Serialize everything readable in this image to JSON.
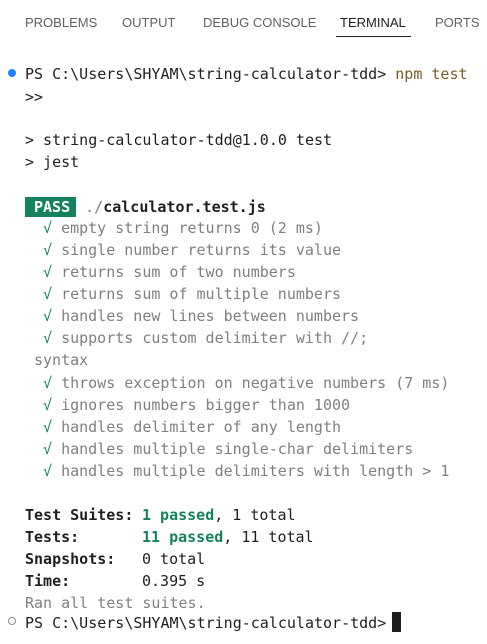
{
  "panel": {
    "tabs": [
      {
        "label": "PROBLEMS"
      },
      {
        "label": "OUTPUT"
      },
      {
        "label": "DEBUG CONSOLE"
      },
      {
        "label": "TERMINAL"
      },
      {
        "label": "PORTS"
      }
    ],
    "active_tab": "TERMINAL"
  },
  "terminal": {
    "prompt": "PS C:\\Users\\SHYAM\\string-calculator-tdd>",
    "command": "npm test",
    "continuation": ">>",
    "script_line_1": "> string-calculator-tdd@1.0.0 test",
    "script_line_2": "> jest",
    "pass_label": "PASS",
    "test_file_dir": "./",
    "test_file_name": "calculator.test.js",
    "check_glyph": "√",
    "tests": [
      "empty string returns 0 (2 ms)",
      "single number returns its value",
      "returns sum of two numbers",
      "returns sum of multiple numbers",
      "handles new lines between numbers",
      "supports custom delimiter with //;",
      "throws exception on negative numbers (7 ms)",
      "ignores numbers bigger than 1000",
      "handles delimiter of any length",
      "handles multiple single-char delimiters",
      "handles multiple delimiters with length > 1"
    ],
    "test_wrap_continuation": "syntax",
    "summary": {
      "suites_label": "Test Suites:",
      "suites_passed": "1 passed",
      "suites_total": ", 1 total",
      "tests_label": "Tests:",
      "tests_passed": "11 passed",
      "tests_total": ", 11 total",
      "snapshots_label": "Snapshots:",
      "snapshots_value": "0 total",
      "time_label": "Time:",
      "time_value": "0.395 s",
      "ran_all": "Ran all test suites."
    },
    "final_prompt": "PS C:\\Users\\SHYAM\\string-calculator-tdd>"
  },
  "colors": {
    "pass_badge": "#16825d",
    "command": "#795e26",
    "prompt_dot": "#1a85ff"
  }
}
